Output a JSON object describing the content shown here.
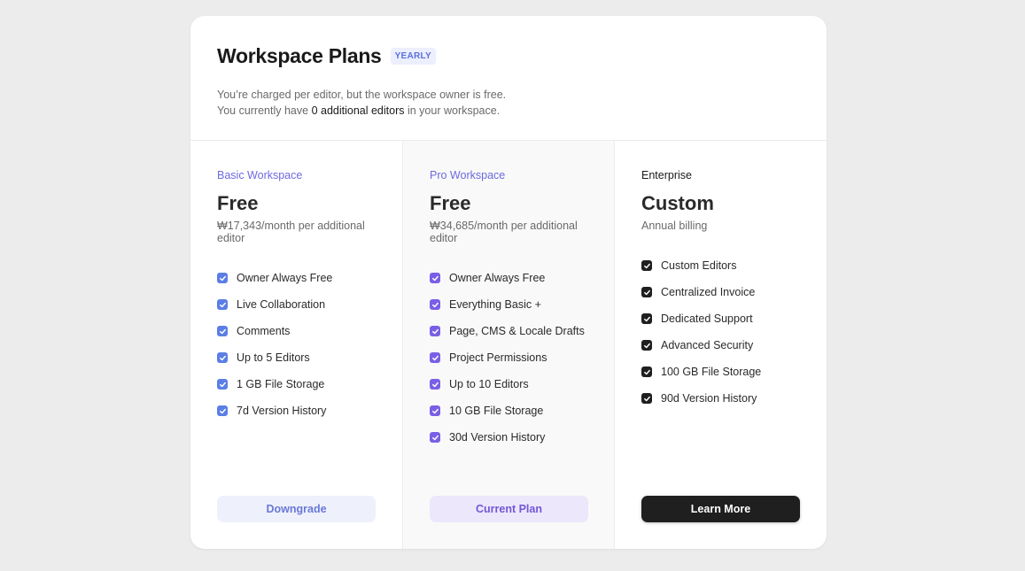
{
  "header": {
    "title": "Workspace Plans",
    "badge": "YEARLY",
    "line1": "You’re charged per editor, but the workspace owner is free.",
    "line2_prefix": "You currently have ",
    "line2_bold": "0 additional editors",
    "line2_suffix": " in your workspace."
  },
  "plans": [
    {
      "tier": "Basic Workspace",
      "price": "Free",
      "note": "₩17,343/month per additional editor",
      "features": [
        "Owner Always Free",
        "Live Collaboration",
        "Comments",
        "Up to 5 Editors",
        "1 GB File Storage",
        "7d Version History"
      ],
      "button": "Downgrade"
    },
    {
      "tier": "Pro Workspace",
      "price": "Free",
      "note": "₩34,685/month per additional editor",
      "features": [
        "Owner Always Free",
        "Everything Basic +",
        "Page, CMS & Locale Drafts",
        "Project Permissions",
        "Up to 10 Editors",
        "10 GB File Storage",
        "30d Version History"
      ],
      "button": "Current Plan"
    },
    {
      "tier": "Enterprise",
      "price": "Custom",
      "note": "Annual billing",
      "features": [
        "Custom Editors",
        "Centralized Invoice",
        "Dedicated Support",
        "Advanced Security",
        "100 GB File Storage",
        "90d Version History"
      ],
      "button": "Learn More"
    }
  ],
  "colors": {
    "basic_accent": "#5b7ee6",
    "pro_accent": "#7a5fe6",
    "enterprise_accent": "#1f1f1f"
  }
}
